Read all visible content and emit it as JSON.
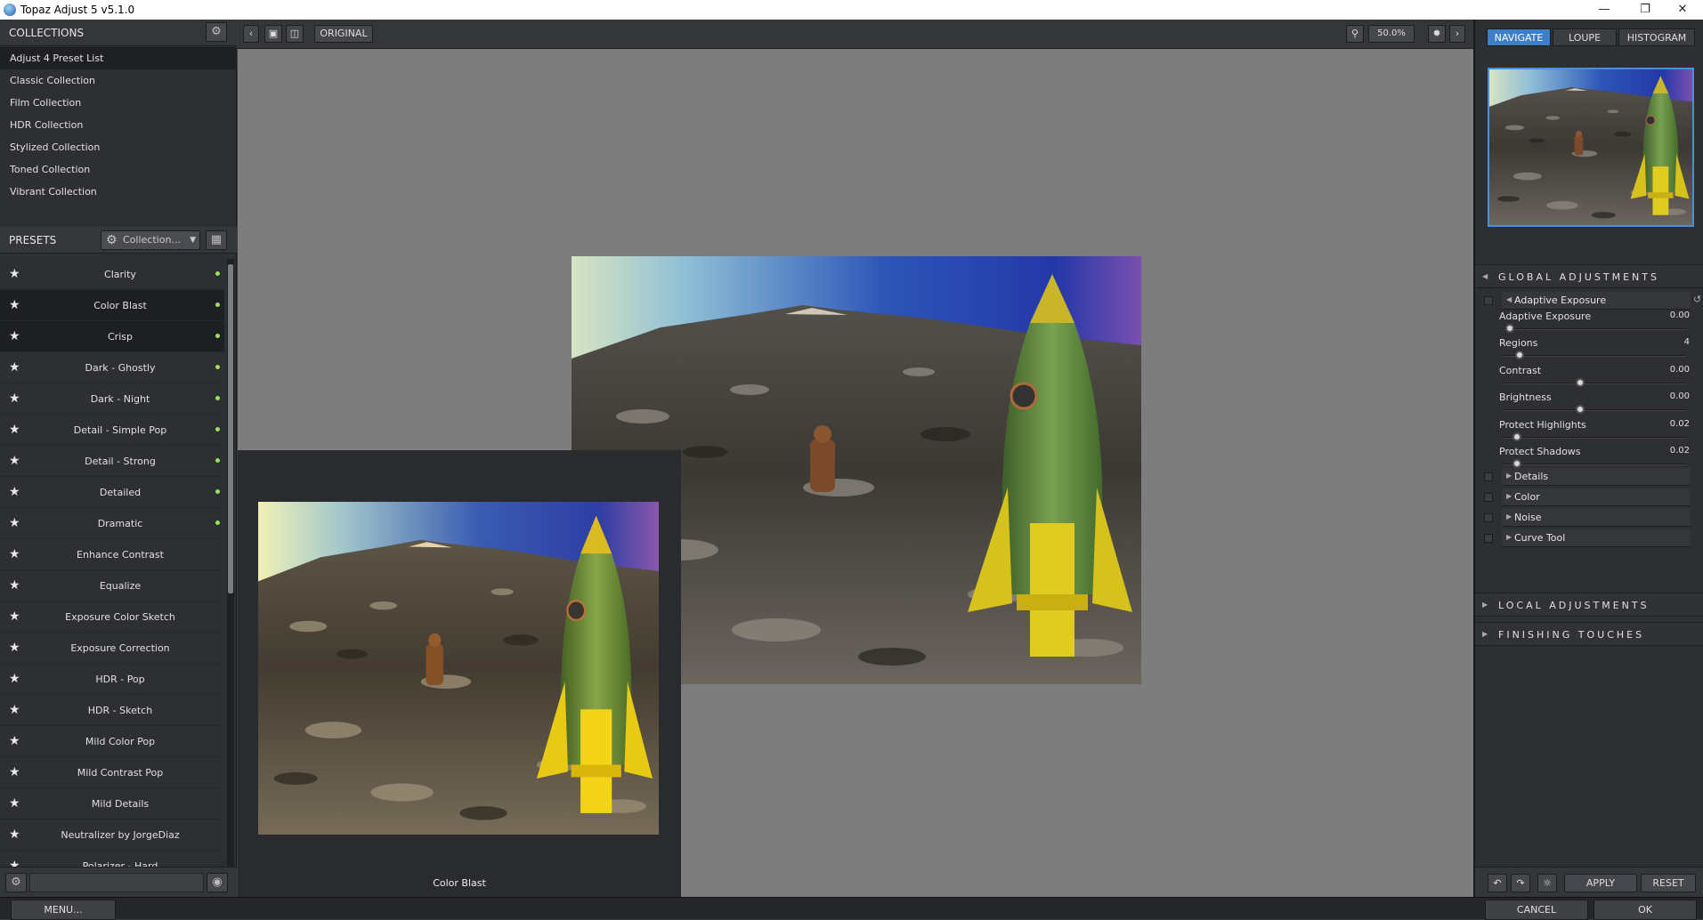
{
  "window": {
    "title": "Topaz Adjust 5 v5.1.0"
  },
  "collections": {
    "header": "COLLECTIONS",
    "items": [
      "Adjust 4 Preset List",
      "Classic Collection",
      "Film Collection",
      "HDR Collection",
      "Stylized Collection",
      "Toned Collection",
      "Vibrant Collection"
    ]
  },
  "presets": {
    "header": "PRESETS",
    "collection_dropdown": "Collection...",
    "items": [
      "Clarity",
      "Color Blast",
      "Crisp",
      "Dark - Ghostly",
      "Dark - Night",
      "Detail - Simple Pop",
      "Detail - Strong",
      "Detailed",
      "Dramatic",
      "Enhance Contrast",
      "Equalize",
      "Exposure Color Sketch",
      "Exposure Correction",
      "HDR - Pop",
      "HDR - Sketch",
      "Mild Color Pop",
      "Mild Contrast Pop",
      "Mild Details",
      "Neutralizer by JorgeDiaz",
      "Polarizer - Hard"
    ]
  },
  "toolbar": {
    "original_label": "ORIGINAL",
    "zoom": "50.0%"
  },
  "canvas": {
    "before_caption": "Color Blast"
  },
  "right_tabs": {
    "navigate": "NAVIGATE",
    "loupe": "LOUPE",
    "histogram": "HISTOGRAM"
  },
  "global_adjustments": {
    "header": "GLOBAL ADJUSTMENTS",
    "adaptive_exposure_group": "Adaptive Exposure",
    "sliders": [
      {
        "label": "Adaptive Exposure",
        "value": "0.00"
      },
      {
        "label": "Regions",
        "value": "4"
      },
      {
        "label": "Contrast",
        "value": "0.00"
      },
      {
        "label": "Brightness",
        "value": "0.00"
      },
      {
        "label": "Protect Highlights",
        "value": "0.02"
      },
      {
        "label": "Protect Shadows",
        "value": "0.02"
      }
    ],
    "subgroups": [
      "Details",
      "Color",
      "Noise",
      "Curve Tool"
    ]
  },
  "local_adjustments": {
    "header": "LOCAL ADJUSTMENTS"
  },
  "finishing_touches": {
    "header": "FINISHING TOUCHES"
  },
  "right_bottom": {
    "apply": "APPLY",
    "reset": "RESET"
  },
  "bottom_bar": {
    "menu": "MENU...",
    "cancel": "CANCEL",
    "ok": "OK"
  },
  "colors": {
    "accent": "#3c7fc7",
    "preset_dot": "#9be05a"
  }
}
